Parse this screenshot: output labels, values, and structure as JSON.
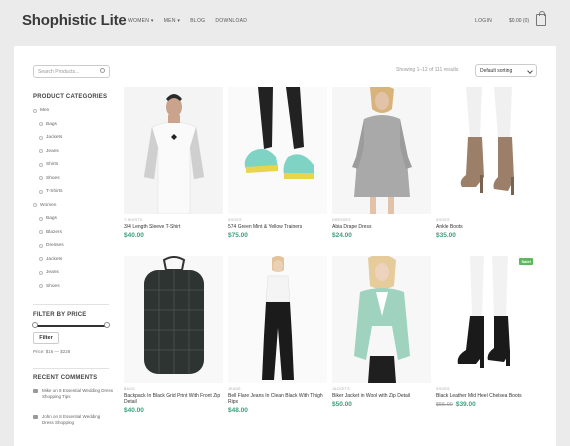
{
  "header": {
    "logo": "Shophistic Lite",
    "nav": [
      "WOMEN ▾",
      "MEN ▾",
      "BLOG",
      "DOWNLOAD"
    ],
    "login": "LOGIN",
    "cart": "$0.00 (0)"
  },
  "sidebar": {
    "search_placeholder": "Search Products...",
    "categories_title": "PRODUCT CATEGORIES",
    "categories": [
      {
        "label": "Men",
        "level": 0
      },
      {
        "label": "Bags",
        "level": 1
      },
      {
        "label": "Jackets",
        "level": 1
      },
      {
        "label": "Jeans",
        "level": 1
      },
      {
        "label": "Shirts",
        "level": 1
      },
      {
        "label": "Shoes",
        "level": 1
      },
      {
        "label": "T-Shirts",
        "level": 1
      },
      {
        "label": "Women",
        "level": 0
      },
      {
        "label": "Bags",
        "level": 1
      },
      {
        "label": "Blazers",
        "level": 1
      },
      {
        "label": "Dresses",
        "level": 1
      },
      {
        "label": "Jackets",
        "level": 1
      },
      {
        "label": "Jeans",
        "level": 1
      },
      {
        "label": "Shoes",
        "level": 1
      }
    ],
    "filter_title": "FILTER BY PRICE",
    "filter_button": "Filter",
    "price_range": "Price: $16 — $228",
    "comments_title": "RECENT COMMENTS",
    "comments": [
      "Mike on 8 Essential Wedding Dress Shopping Tips",
      "John on 8 Essential Wedding Dress Shopping"
    ]
  },
  "toolbar": {
    "showing": "Showing 1–12 of 111 results",
    "sort": "Default sorting"
  },
  "products": [
    {
      "tag": "T-SHIRTS",
      "name": "3/4 Length Sleeve T-Shirt",
      "price": "$40.00"
    },
    {
      "tag": "SHOES",
      "name": "574 Green Mint & Yellow Trainers",
      "price": "$75.00"
    },
    {
      "tag": "DRESSES",
      "name": "Abia Drape Dress",
      "price": "$24.00"
    },
    {
      "tag": "SHOES",
      "name": "Ankle Boots",
      "price": "$35.00"
    },
    {
      "tag": "BAGS",
      "name": "Backpack In Black Grid Print With Front Zip Detail",
      "price": "$40.00"
    },
    {
      "tag": "JEANS",
      "name": "Bell Flare Jeans In Clean Black With Thigh Rips",
      "price": "$48.00"
    },
    {
      "tag": "JACKETS",
      "name": "Biker Jacket in Wool with Zip Detail",
      "price": "$50.00"
    },
    {
      "tag": "SHOES",
      "name": "Black Leather Mid Heel Chelsea Boots",
      "old_price": "$55.00",
      "price": "$39.00",
      "badge": "Sale!"
    }
  ]
}
